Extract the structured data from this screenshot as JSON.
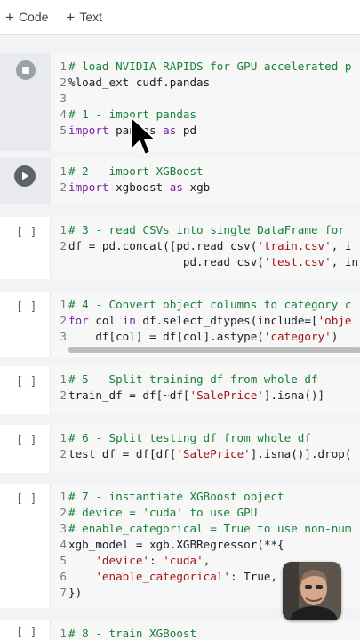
{
  "toolbar": {
    "code_label": "Code",
    "text_label": "Text"
  },
  "cells": [
    {
      "bracket": "",
      "lines": [
        {
          "n": "1",
          "parts": [
            {
              "t": "# load NVIDIA RAPIDS for GPU accelerated p",
              "c": "comment"
            }
          ]
        },
        {
          "n": "2",
          "parts": [
            {
              "t": "%load_ext cudf.pandas",
              "c": "plain"
            }
          ]
        },
        {
          "n": "3",
          "parts": [
            {
              "t": "",
              "c": "plain"
            }
          ]
        },
        {
          "n": "4",
          "parts": [
            {
              "t": "# 1 - import pandas",
              "c": "comment"
            }
          ]
        },
        {
          "n": "5",
          "parts": [
            {
              "t": "import",
              "c": "keyword"
            },
            {
              "t": " pandas ",
              "c": "plain"
            },
            {
              "t": "as",
              "c": "keyword"
            },
            {
              "t": " pd",
              "c": "plain"
            }
          ]
        }
      ]
    },
    {
      "bracket": "",
      "lines": [
        {
          "n": "1",
          "parts": [
            {
              "t": "# 2 - import XGBoost",
              "c": "comment"
            }
          ]
        },
        {
          "n": "2",
          "parts": [
            {
              "t": "import",
              "c": "keyword"
            },
            {
              "t": " xgboost ",
              "c": "plain"
            },
            {
              "t": "as",
              "c": "keyword"
            },
            {
              "t": " xgb",
              "c": "plain"
            }
          ]
        }
      ]
    },
    {
      "bracket": "[ ]",
      "lines": [
        {
          "n": "1",
          "parts": [
            {
              "t": "# 3 - read CSVs into single DataFrame for",
              "c": "comment"
            }
          ]
        },
        {
          "n": "2",
          "parts": [
            {
              "t": "df = pd.concat([pd.read_csv(",
              "c": "plain"
            },
            {
              "t": "'train.csv'",
              "c": "string"
            },
            {
              "t": ", i",
              "c": "plain"
            }
          ]
        },
        {
          "n": "",
          "parts": [
            {
              "t": "                 pd.read_csv(",
              "c": "plain"
            },
            {
              "t": "'test.csv'",
              "c": "string"
            },
            {
              "t": ", in",
              "c": "plain"
            }
          ]
        }
      ]
    },
    {
      "bracket": "[ ]",
      "lines": [
        {
          "n": "1",
          "parts": [
            {
              "t": "# 4 - Convert object columns to category c",
              "c": "comment"
            }
          ]
        },
        {
          "n": "2",
          "parts": [
            {
              "t": "for",
              "c": "keyword"
            },
            {
              "t": " col ",
              "c": "plain"
            },
            {
              "t": "in",
              "c": "keyword"
            },
            {
              "t": " df.select_dtypes(include=[",
              "c": "plain"
            },
            {
              "t": "'obje",
              "c": "string"
            }
          ]
        },
        {
          "n": "3",
          "parts": [
            {
              "t": "    df[col] = df[col].astype(",
              "c": "plain"
            },
            {
              "t": "'category'",
              "c": "string"
            },
            {
              "t": ")",
              "c": "plain"
            }
          ]
        }
      ]
    },
    {
      "bracket": "[ ]",
      "lines": [
        {
          "n": "1",
          "parts": [
            {
              "t": "# 5 - Split training df from whole df",
              "c": "comment"
            }
          ]
        },
        {
          "n": "2",
          "parts": [
            {
              "t": "train_df = df[~df[",
              "c": "plain"
            },
            {
              "t": "'SalePrice'",
              "c": "string"
            },
            {
              "t": "].isna()]",
              "c": "plain"
            }
          ]
        }
      ]
    },
    {
      "bracket": "[ ]",
      "lines": [
        {
          "n": "1",
          "parts": [
            {
              "t": "# 6 - Split testing df from whole df",
              "c": "comment"
            }
          ]
        },
        {
          "n": "2",
          "parts": [
            {
              "t": "test_df = df[df[",
              "c": "plain"
            },
            {
              "t": "'SalePrice'",
              "c": "string"
            },
            {
              "t": "].isna()].drop(",
              "c": "plain"
            }
          ]
        }
      ]
    },
    {
      "bracket": "[ ]",
      "lines": [
        {
          "n": "1",
          "parts": [
            {
              "t": "# 7 - instantiate XGBoost object",
              "c": "comment"
            }
          ]
        },
        {
          "n": "2",
          "parts": [
            {
              "t": "# device = 'cuda' to use GPU",
              "c": "comment"
            }
          ]
        },
        {
          "n": "3",
          "parts": [
            {
              "t": "# enable_categorical = True to use non-num",
              "c": "comment"
            }
          ]
        },
        {
          "n": "4",
          "parts": [
            {
              "t": "xgb_model = xgb.XGBRegressor(**{",
              "c": "plain"
            }
          ]
        },
        {
          "n": "5",
          "parts": [
            {
              "t": "    ",
              "c": "plain"
            },
            {
              "t": "'device'",
              "c": "string"
            },
            {
              "t": ": ",
              "c": "plain"
            },
            {
              "t": "'cuda'",
              "c": "string"
            },
            {
              "t": ",",
              "c": "plain"
            }
          ]
        },
        {
          "n": "6",
          "parts": [
            {
              "t": "    ",
              "c": "plain"
            },
            {
              "t": "'enable_categorical'",
              "c": "string"
            },
            {
              "t": ": True,",
              "c": "plain"
            }
          ]
        },
        {
          "n": "7",
          "parts": [
            {
              "t": "})",
              "c": "plain"
            }
          ]
        }
      ]
    },
    {
      "bracket": "[ ]",
      "lines": [
        {
          "n": "1",
          "parts": [
            {
              "t": "# 8 - train XGBoost",
              "c": "comment"
            }
          ]
        }
      ]
    }
  ]
}
